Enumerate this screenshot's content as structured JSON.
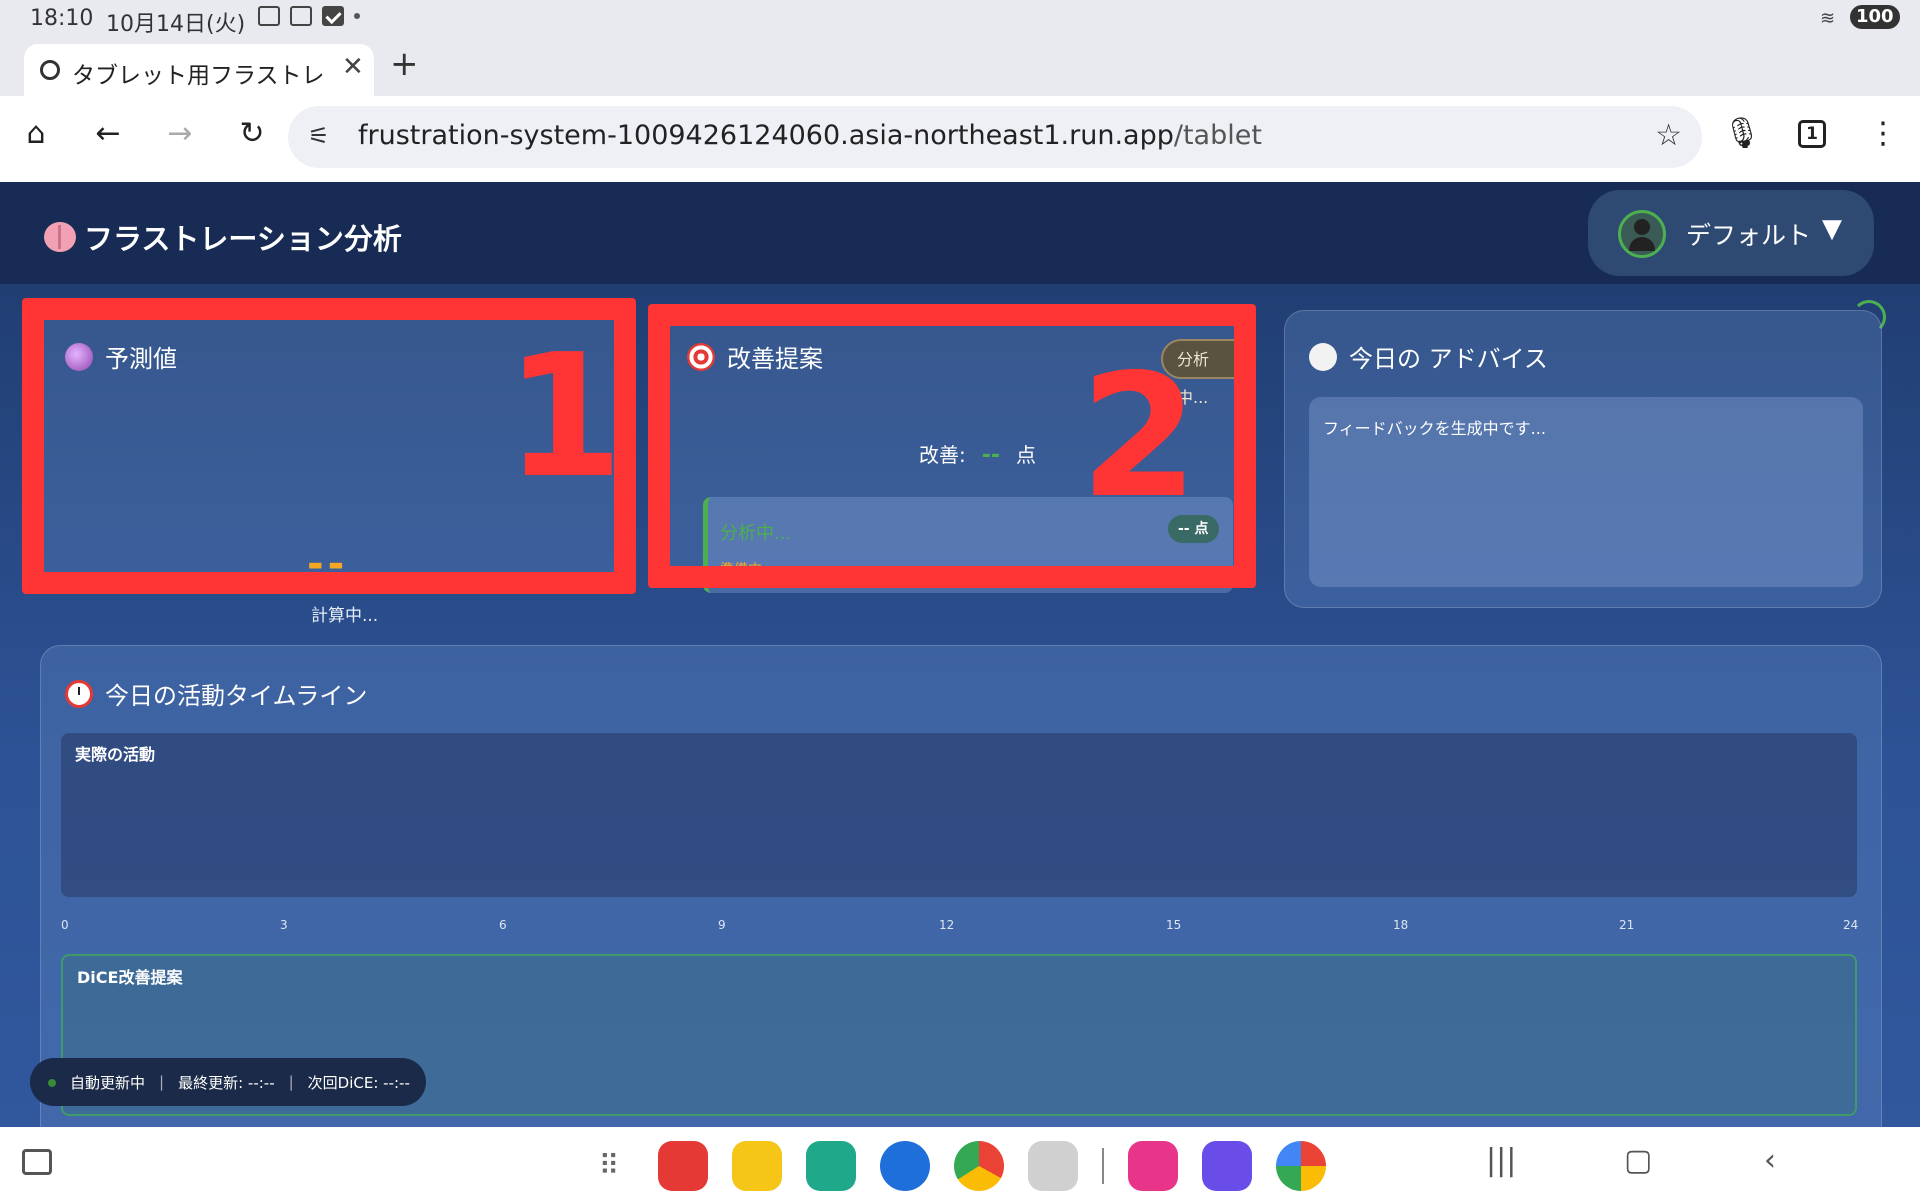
{
  "status_bar": {
    "time": "18:10",
    "date": "10月14日(火)",
    "battery": "100"
  },
  "browser": {
    "tab_title": "タブレット用フラストレ",
    "url_host": "frustration-system-1009426124060.asia-northeast1.run.app",
    "url_path": "/tablet",
    "tab_count": "1"
  },
  "app": {
    "title": "フラストレーション分析",
    "user_select_value": "デフォルト",
    "prediction": {
      "title": "予測値",
      "value": "--",
      "status": "計算中..."
    },
    "improvement": {
      "title": "改善提案",
      "status_pill": "分析中...",
      "improve_label": "改善:",
      "improve_value": "--",
      "improve_unit": "点",
      "suggestion_title": "分析中...",
      "suggestion_sub": "準備中...",
      "suggestion_points": "-- 点"
    },
    "advice": {
      "title": "今日の アドバイス",
      "text": "フィードバックを生成中です..."
    },
    "timeline": {
      "title": "今日の活動タイムライン",
      "actual_label": "実際の活動",
      "dice_label": "DiCE改善提案",
      "ticks": [
        "0",
        "3",
        "6",
        "9",
        "12",
        "15",
        "18",
        "21",
        "24"
      ]
    },
    "auto_status": {
      "state": "自動更新中",
      "last_update": "最終更新: --:--",
      "next_dice": "次回DiCE: --:--"
    }
  },
  "annotations": [
    "1",
    "2"
  ],
  "colors": {
    "header_bg": "#172b55",
    "accent_green": "#4caf50",
    "accent_orange": "#f5a623",
    "annotation_red": "#ff3434"
  }
}
